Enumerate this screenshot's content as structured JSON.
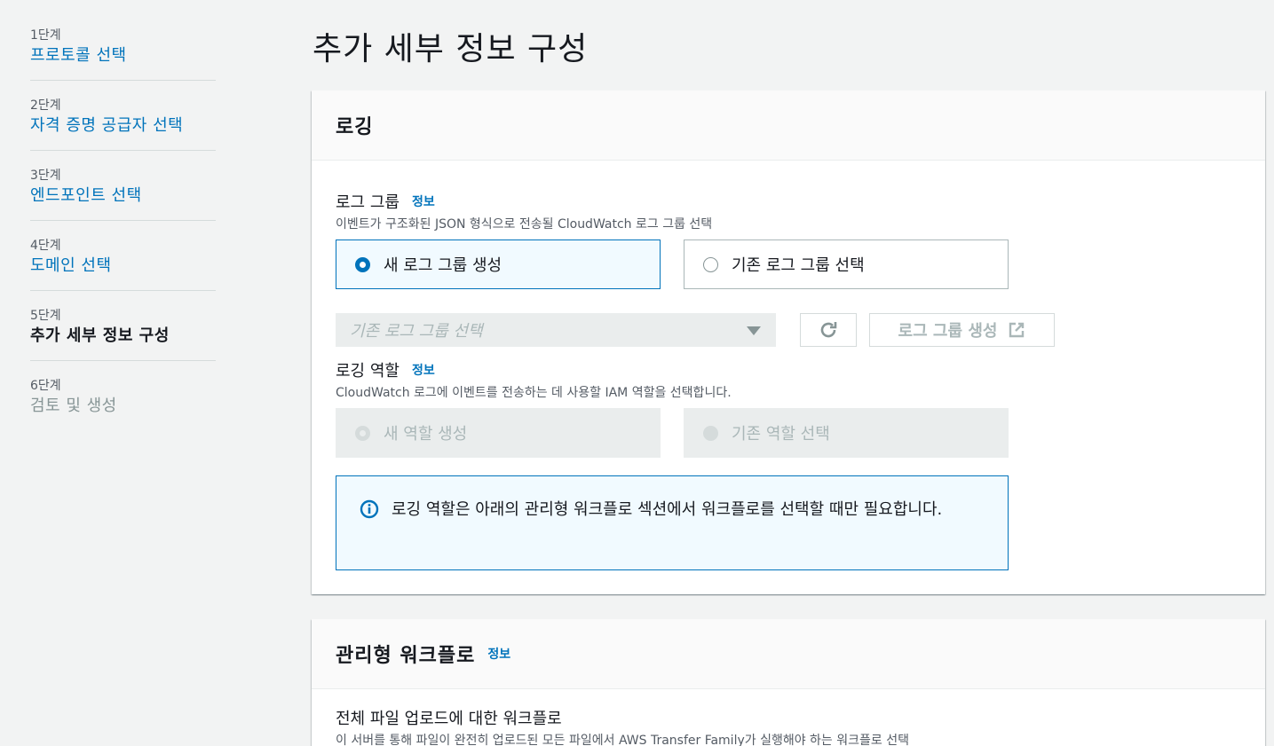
{
  "steps": [
    {
      "num": "1단계",
      "title": "프로토콜 선택",
      "state": "link"
    },
    {
      "num": "2단계",
      "title": "자격 증명 공급자 선택",
      "state": "link"
    },
    {
      "num": "3단계",
      "title": "엔드포인트 선택",
      "state": "link"
    },
    {
      "num": "4단계",
      "title": "도메인 선택",
      "state": "link"
    },
    {
      "num": "5단계",
      "title": "추가 세부 정보 구성",
      "state": "active"
    },
    {
      "num": "6단계",
      "title": "검토 및 생성",
      "state": "disabled"
    }
  ],
  "page_title": "추가 세부 정보 구성",
  "logging": {
    "title": "로깅",
    "log_group": {
      "label": "로그 그룹",
      "info": "정보",
      "description": "이벤트가 구조화된 JSON 형식으로 전송될 CloudWatch 로그 그룹 선택",
      "option_new": "새 로그 그룹 생성",
      "option_existing": "기존 로그 그룹 선택",
      "select_placeholder": "기존 로그 그룹 선택",
      "create_button": "로그 그룹 생성"
    },
    "role": {
      "label": "로깅 역할",
      "info": "정보",
      "description": "CloudWatch 로그에 이벤트를 전송하는 데 사용할 IAM 역할을 선택합니다.",
      "option_new": "새 역할 생성",
      "option_existing": "기존 역할 선택"
    },
    "alert_text": "로깅 역할은 아래의 관리형 워크플로 섹션에서 워크플로를 선택할 때만 필요합니다."
  },
  "workflow": {
    "title": "관리형 워크플로",
    "info": "정보",
    "full_upload_label": "전체 파일 업로드에 대한 워크플로",
    "full_upload_desc": "이 서버를 통해 파일이 완전히 업로드된 모든 파일에서 AWS Transfer Family가 실행해야 하는 워크플로 선택"
  },
  "colors": {
    "link": "#0073bb",
    "selected_bg": "#f1faff",
    "disabled_bg": "#eaeded"
  }
}
